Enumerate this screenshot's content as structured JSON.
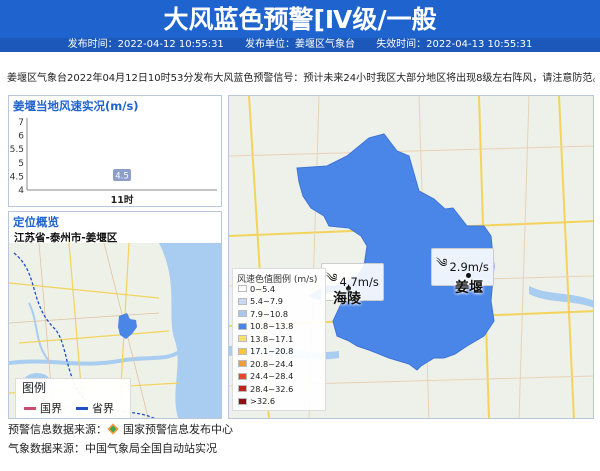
{
  "header": {
    "title": "大风蓝色预警[Ⅳ级/一般",
    "publish_time": "发布时间：2022-04-12 10:55:31",
    "publisher": "发布单位：姜堰区气象台",
    "expire_time": "失效时间：2022-04-13 10:55:31"
  },
  "description": "姜堰区气象台2022年04月12日10时53分发布大风蓝色预警信号：预计未来24小时我区大部分地区将出现8级左右阵风，请注意防范。",
  "wind_panel": {
    "title": "姜堰当地风速实况(m/s)"
  },
  "chart_data": {
    "type": "bar",
    "categories": [
      "11时"
    ],
    "values": [
      4.5
    ],
    "data_labels": [
      "4.5"
    ],
    "yticks": [
      "7",
      "6",
      "5.5",
      "5",
      "4.5",
      "4"
    ],
    "ylim": [
      4,
      7
    ],
    "colors": {
      "bar": "#8d9fc9",
      "label_bg": "#8d9fc9"
    }
  },
  "location_panel": {
    "title": "定位概览",
    "location": "江苏省-泰州市-姜堰区",
    "legend": {
      "title": "图例",
      "items": [
        {
          "label": "国界",
          "color": "#c94b6e"
        },
        {
          "label": "省界",
          "color": "#1f4fc8"
        }
      ]
    }
  },
  "map": {
    "legend_title": "风速色值图例 (m/s)",
    "legend_items": [
      {
        "label": "0~5.4",
        "color": "#ffffff"
      },
      {
        "label": "5.4~7.9",
        "color": "#c9d9f3"
      },
      {
        "label": "7.9~10.8",
        "color": "#a9c7ee"
      },
      {
        "label": "10.8~13.8",
        "color": "#4a86e8"
      },
      {
        "label": "13.8~17.1",
        "color": "#f5e26b"
      },
      {
        "label": "17.1~20.8",
        "color": "#f5c542"
      },
      {
        "label": "20.8~24.4",
        "color": "#f29b38"
      },
      {
        "label": "24.4~28.4",
        "color": "#e8452c"
      },
      {
        "label": "28.4~32.6",
        "color": "#c8201e"
      },
      {
        "label": ">32.6",
        "color": "#8b0f13"
      }
    ],
    "stations": [
      {
        "name": "海陵",
        "value": "4.7m/s"
      },
      {
        "name": "姜堰",
        "value": "2.9m/s"
      }
    ],
    "region_color": "#4a86e8"
  },
  "footer": {
    "warning_source": "预警信息数据来源：",
    "warning_source_name": "国家预警信息发布中心",
    "weather_source": "气象数据来源：中国气象局全国自动站实况"
  }
}
